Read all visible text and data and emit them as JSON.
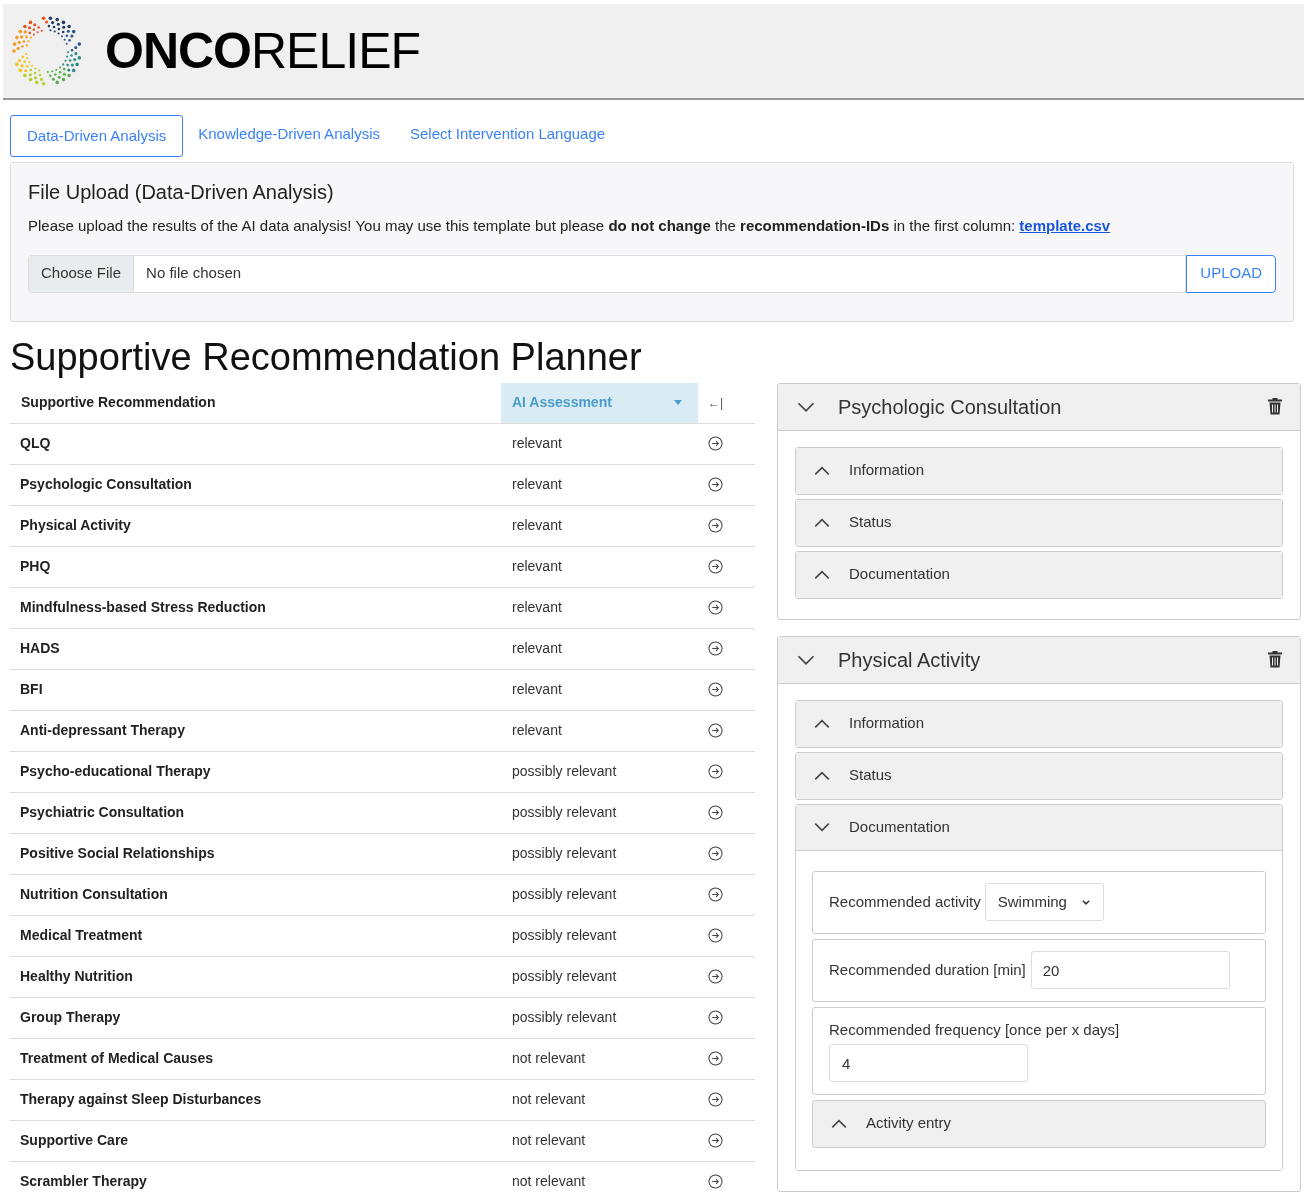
{
  "brand": {
    "logo_text": "**ONCO**RELIEF"
  },
  "tabs": [
    {
      "label": "Data-Driven Analysis",
      "selected": true
    },
    {
      "label": "Knowledge-Driven Analysis",
      "selected": false
    },
    {
      "label": "Select Intervention Language",
      "selected": false
    }
  ],
  "upload": {
    "title": "File Upload (Data-Driven Analysis)",
    "description": "Please upload the results of the AI data analysis! You may use this template but please **do not change** the **recommendation-IDs** in the first column: ",
    "link": "template.csv",
    "choose_button": "Choose File",
    "file_status": "No file chosen",
    "upload_button": "UPLOAD"
  },
  "page_title": "Supportive Recommendation Planner",
  "table": {
    "columns": [
      "Supportive Recommendation",
      "AI Assessment"
    ],
    "collapse_icon": "←|",
    "rows": [
      {
        "name": "QLQ",
        "assessment": "relevant"
      },
      {
        "name": "Psychologic Consultation",
        "assessment": "relevant"
      },
      {
        "name": "Physical Activity",
        "assessment": "relevant"
      },
      {
        "name": "PHQ",
        "assessment": "relevant"
      },
      {
        "name": "Mindfulness-based Stress Reduction",
        "assessment": "relevant"
      },
      {
        "name": "HADS",
        "assessment": "relevant"
      },
      {
        "name": "BFI",
        "assessment": "relevant"
      },
      {
        "name": "Anti-depressant Therapy",
        "assessment": "relevant"
      },
      {
        "name": "Psycho-educational Therapy",
        "assessment": "possibly relevant"
      },
      {
        "name": "Psychiatric Consultation",
        "assessment": "possibly relevant"
      },
      {
        "name": "Positive Social Relationships",
        "assessment": "possibly relevant"
      },
      {
        "name": "Nutrition Consultation",
        "assessment": "possibly relevant"
      },
      {
        "name": "Medical Treatment",
        "assessment": "possibly relevant"
      },
      {
        "name": "Healthy Nutrition",
        "assessment": "possibly relevant"
      },
      {
        "name": "Group Therapy",
        "assessment": "possibly relevant"
      },
      {
        "name": "Treatment of Medical Causes",
        "assessment": "not relevant"
      },
      {
        "name": "Therapy against Sleep Disturbances",
        "assessment": "not relevant"
      },
      {
        "name": "Supportive Care",
        "assessment": "not relevant"
      },
      {
        "name": "Scrambler Therapy",
        "assessment": "not relevant"
      }
    ]
  },
  "panels": [
    {
      "title": "Psychologic Consultation",
      "expanded": true,
      "sections": [
        {
          "title": "Information",
          "expanded": false
        },
        {
          "title": "Status",
          "expanded": false
        },
        {
          "title": "Documentation",
          "expanded": false
        }
      ]
    },
    {
      "title": "Physical Activity",
      "expanded": true,
      "sections": [
        {
          "title": "Information",
          "expanded": false
        },
        {
          "title": "Status",
          "expanded": false
        },
        {
          "title": "Documentation",
          "expanded": true,
          "items": [
            {
              "kind": "select",
              "label": "Recommended activity",
              "value": "Swimming"
            },
            {
              "kind": "inline_input",
              "label": "Recommended duration [min]",
              "value": "20"
            },
            {
              "kind": "stacked_input",
              "label": "Recommended frequency [once per x days]",
              "value": "4"
            },
            {
              "kind": "accordion",
              "label": "Activity entry",
              "expanded": false
            }
          ]
        }
      ]
    }
  ]
}
